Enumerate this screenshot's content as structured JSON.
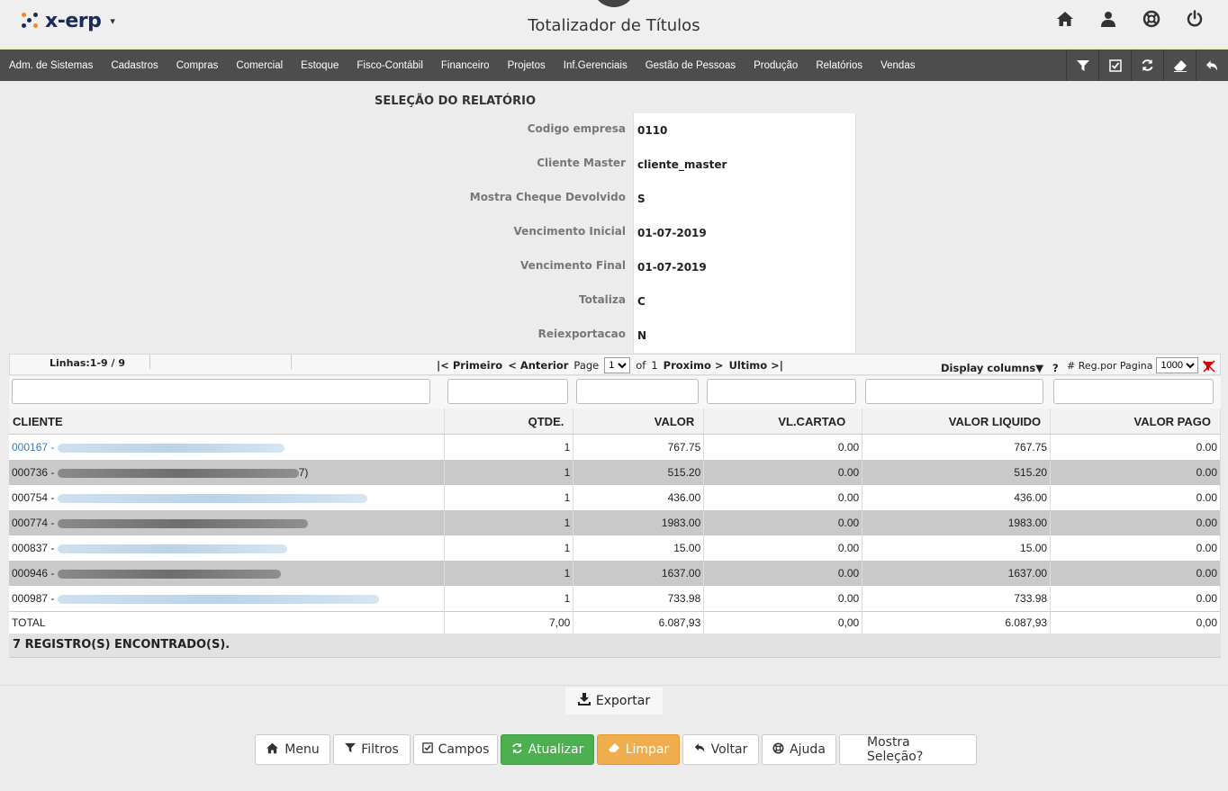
{
  "header": {
    "logo_text": "x-erp",
    "title": "Totalizador de Títulos"
  },
  "menu": [
    "Adm. de Sistemas",
    "Cadastros",
    "Compras",
    "Comercial",
    "Estoque",
    "Fisco-Contábil",
    "Financeiro",
    "Projetos",
    "Inf.Gerenciais",
    "Gestão de Pessoas",
    "Produção",
    "Relatórios",
    "Vendas"
  ],
  "selection": {
    "title": "SELEÇÃO DO RELATÓRIO",
    "fields": [
      {
        "label": "Codigo empresa",
        "value": "0110"
      },
      {
        "label": "Cliente Master",
        "value": "cliente_master"
      },
      {
        "label": "Mostra Cheque Devolvido",
        "value": "S"
      },
      {
        "label": "Vencimento Inicial",
        "value": "01-07-2019"
      },
      {
        "label": "Vencimento Final",
        "value": "01-07-2019"
      },
      {
        "label": "Totaliza",
        "value": "C"
      },
      {
        "label": "Reiexportacao",
        "value": "N"
      }
    ]
  },
  "pager": {
    "linhas": "Linhas:1-9 / 9",
    "primeiro": "|< Primeiro",
    "anterior": "< Anterior",
    "page_label": "Page",
    "page_value": "1",
    "of_label": "of",
    "total_pages": "1",
    "proximo": "Proximo >",
    "ultimo": "Ultimo >|",
    "display_columns": "Display columns▼",
    "help": "?",
    "reg_label": "# Reg.por Pagina",
    "reg_value": "1000"
  },
  "table": {
    "headers": [
      "CLIENTE",
      "QTDE.",
      "VALOR",
      "VL.CARTAO",
      "VALOR LIQUIDO",
      "VALOR PAGO"
    ],
    "rows": [
      {
        "code": "000167 -",
        "suffix": "",
        "qtde": "1",
        "valor": "767.75",
        "vl_cartao": "0.00",
        "valor_liquido": "767.75",
        "valor_pago": "0.00"
      },
      {
        "code": "000736 -",
        "suffix": "7)",
        "qtde": "1",
        "valor": "515.20",
        "vl_cartao": "0.00",
        "valor_liquido": "515.20",
        "valor_pago": "0.00"
      },
      {
        "code": "000754 -",
        "suffix": "",
        "qtde": "1",
        "valor": "436.00",
        "vl_cartao": "0.00",
        "valor_liquido": "436.00",
        "valor_pago": "0.00"
      },
      {
        "code": "000774 -",
        "suffix": "",
        "qtde": "1",
        "valor": "1983.00",
        "vl_cartao": "0.00",
        "valor_liquido": "1983.00",
        "valor_pago": "0.00"
      },
      {
        "code": "000837 -",
        "suffix": "",
        "qtde": "1",
        "valor": "15.00",
        "vl_cartao": "0.00",
        "valor_liquido": "15.00",
        "valor_pago": "0.00"
      },
      {
        "code": "000946 -",
        "suffix": "",
        "qtde": "1",
        "valor": "1637.00",
        "vl_cartao": "0.00",
        "valor_liquido": "1637.00",
        "valor_pago": "0.00"
      },
      {
        "code": "000987 -",
        "suffix": "",
        "qtde": "1",
        "valor": "733.98",
        "vl_cartao": "0.00",
        "valor_liquido": "733.98",
        "valor_pago": "0.00"
      }
    ],
    "total": {
      "label": "TOTAL",
      "qtde": "7,00",
      "valor": "6.087,93",
      "vl_cartao": "0,00",
      "valor_liquido": "6.087,93",
      "valor_pago": "0,00"
    },
    "found": "7 REGISTRO(S) ENCONTRADO(S)."
  },
  "export_label": "Exportar",
  "buttons": {
    "menu": "Menu",
    "filtros": "Filtros",
    "campos": "Campos",
    "atualizar": "Atualizar",
    "limpar": "Limpar",
    "voltar": "Voltar",
    "ajuda": "Ajuda",
    "mostra": "Mostra Seleção?"
  },
  "colors": {
    "header_bg": "#efefef",
    "menubar_bg": "#4d4d4d",
    "row_alt": "#c9c9c9",
    "link": "#3a7ab8",
    "btn_green": "#4cb050",
    "btn_orange": "#f0ad4e"
  }
}
